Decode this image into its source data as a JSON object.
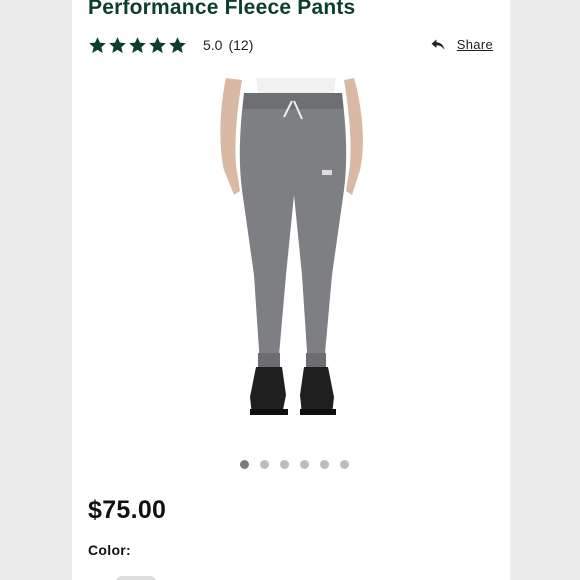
{
  "product": {
    "title": "Performance Fleece Pants",
    "rating_value": "5.0",
    "review_count": "(12)",
    "stars": 5,
    "price": "$75.00",
    "color_label": "Color:"
  },
  "share": {
    "label": "Share",
    "icon": "share-arrow-icon"
  },
  "carousel": {
    "image_count": 6,
    "active_index": 0
  },
  "colors": {
    "brand_green": "#0b3f2c",
    "dot_active": "#7b7b7b",
    "dot_inactive": "#bdbdbd"
  }
}
